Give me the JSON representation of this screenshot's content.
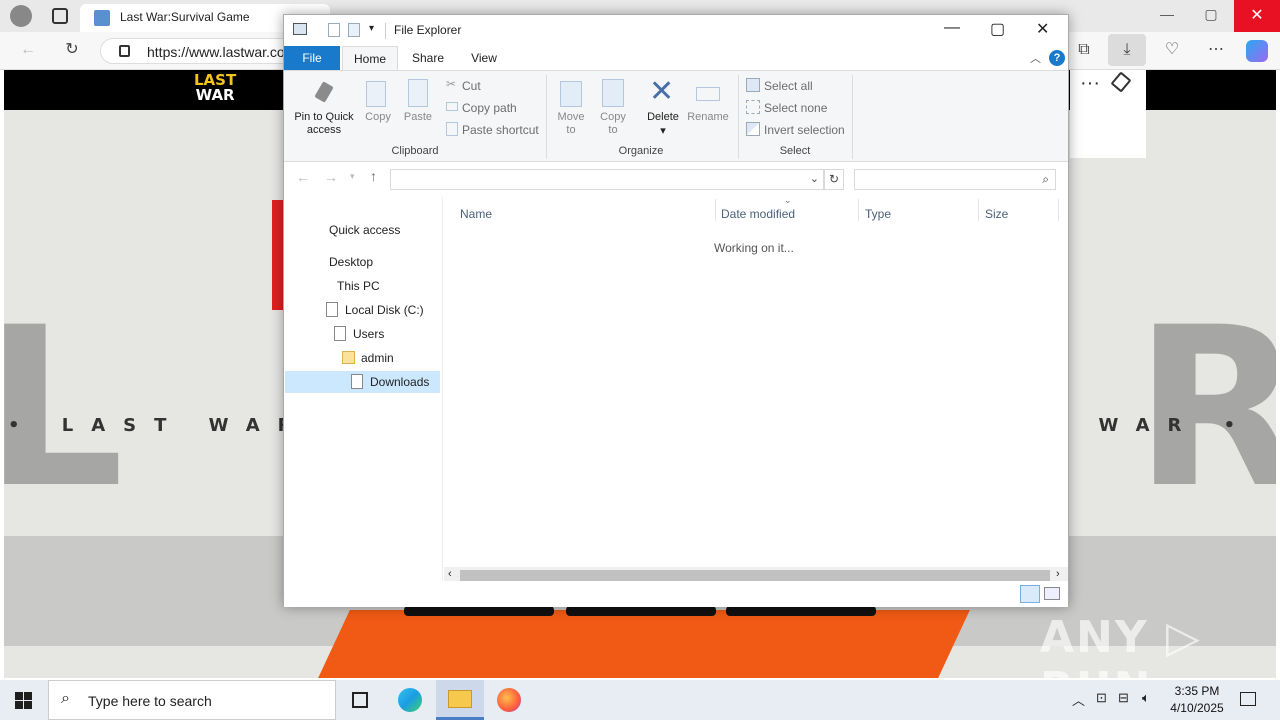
{
  "browser": {
    "tab_title": "Last War:Survival Game",
    "url": "https://www.lastwar.co",
    "minimize": "—",
    "maximize": "▢",
    "close": "✕"
  },
  "site": {
    "logo_line1": "LAST",
    "logo_line2": "WAR",
    "banner_left": "• LAST WAR • L",
    "banner_right": "T WAR • L",
    "watermark": "ANY ▷ RUN",
    "overlay_menu": "···"
  },
  "explorer": {
    "title": "File Explorer",
    "tabs": [
      "File",
      "Home",
      "Share",
      "View"
    ],
    "clipboard": {
      "pin": "Pin to Quick access",
      "pin_l1": "Pin to Quick",
      "pin_l2": "access",
      "copy": "Copy",
      "paste": "Paste",
      "cut": "Cut",
      "copy_path": "Copy path",
      "paste_shortcut": "Paste shortcut",
      "group": "Clipboard"
    },
    "organize": {
      "move_to_l1": "Move",
      "move_to_l2": "to",
      "copy_to_l1": "Copy",
      "copy_to_l2": "to",
      "delete": "Delete",
      "rename": "Rename",
      "group": "Organize"
    },
    "select": {
      "select_all": "Select all",
      "select_none": "Select none",
      "invert": "Invert selection",
      "group": "Select"
    },
    "address_value": "",
    "search_placeholder": "",
    "nav": [
      {
        "label": "Quick access"
      },
      {
        "label": "Desktop"
      },
      {
        "label": "This PC"
      },
      {
        "label": "Local Disk (C:)"
      },
      {
        "label": "Users"
      },
      {
        "label": "admin"
      },
      {
        "label": "Downloads"
      }
    ],
    "columns": [
      "Name",
      "Date modified",
      "Type",
      "Size"
    ],
    "status_message": "Working on it..."
  },
  "taskbar": {
    "search_placeholder": "Type here to search",
    "time": "3:35 PM",
    "date": "4/10/2025"
  },
  "colors": {
    "accent": "#1979ca",
    "selection": "#cce8ff",
    "site_orange": "#f05a14"
  }
}
